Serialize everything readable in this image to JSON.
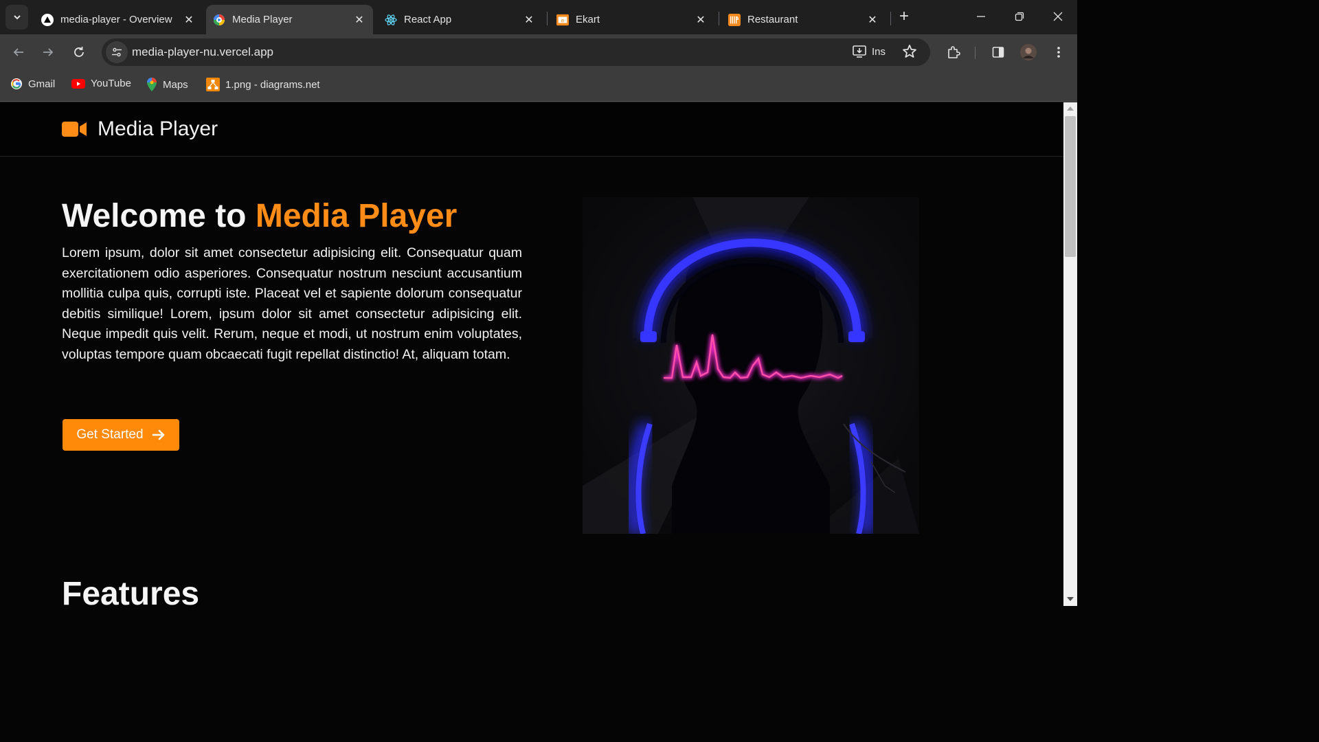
{
  "browser": {
    "tabs": [
      {
        "title": "media-player - Overview"
      },
      {
        "title": "Media Player"
      },
      {
        "title": "React App"
      },
      {
        "title": "Ekart"
      },
      {
        "title": "Restaurant"
      }
    ],
    "url": "media-player-nu.vercel.app",
    "install_label": "Ins",
    "bookmarks": [
      {
        "label": "Gmail"
      },
      {
        "label": "YouTube"
      },
      {
        "label": "Maps"
      },
      {
        "label": "1.png - diagrams.net"
      }
    ]
  },
  "site": {
    "brand": "Media Player",
    "hero": {
      "title_prefix": "Welcome to ",
      "title_accent": "Media Player",
      "body": "Lorem ipsum, dolor sit amet consectetur adipisicing elit. Consequatur quam exercitationem odio asperiores. Consequatur nostrum nesciunt accusantium mollitia culpa quis, corrupti iste. Placeat vel et sapiente dolorum consequatur debitis similique! Lorem, ipsum dolor sit amet consectetur adipisicing elit. Neque impedit quis velit. Rerum, neque et modi, ut nostrum enim voluptates, voluptas tempore quam obcaecati fugit repellat distinctio! At, aliquam totam.",
      "cta_label": "Get Started"
    },
    "features_heading": "Features"
  },
  "colors": {
    "accent": "#ff8c17",
    "page_bg": "#050505",
    "chrome_bg": "#3c3c3c"
  }
}
